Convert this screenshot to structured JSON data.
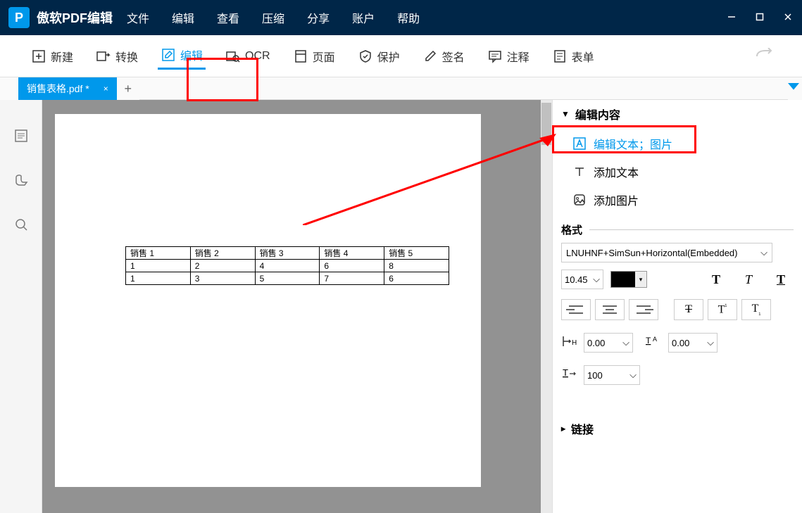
{
  "app_name": "傲软PDF编辑",
  "menu": [
    "文件",
    "编辑",
    "查看",
    "压缩",
    "分享",
    "账户",
    "帮助"
  ],
  "toolbar": [
    {
      "label": "新建",
      "name": "new"
    },
    {
      "label": "转换",
      "name": "convert"
    },
    {
      "label": "编辑",
      "name": "edit",
      "active": true
    },
    {
      "label": "OCR",
      "name": "ocr"
    },
    {
      "label": "页面",
      "name": "page"
    },
    {
      "label": "保护",
      "name": "protect"
    },
    {
      "label": "签名",
      "name": "sign"
    },
    {
      "label": "注释",
      "name": "annotate"
    },
    {
      "label": "表单",
      "name": "form"
    }
  ],
  "tab": {
    "filename": "销售表格.pdf *"
  },
  "chart_data": {
    "type": "table",
    "headers": [
      "销售 1",
      "销售 2",
      "销售 3",
      "销售 4",
      "销售 5"
    ],
    "rows": [
      [
        "1",
        "2",
        "4",
        "6",
        "8"
      ],
      [
        "1",
        "3",
        "5",
        "7",
        "6"
      ]
    ]
  },
  "panel": {
    "edit_content_title": "编辑内容",
    "options": [
      {
        "label": "编辑文本；图片",
        "active": true,
        "name": "edit-text-image"
      },
      {
        "label": "添加文本",
        "name": "add-text"
      },
      {
        "label": "添加图片",
        "name": "add-image"
      }
    ],
    "format_title": "格式",
    "font_name": "LNUHNF+SimSun+Horizontal(Embedded)",
    "font_size": "10.45",
    "char_spacing": "0.00",
    "line_spacing": "0.00",
    "scale": "100",
    "link_title": "链接"
  }
}
